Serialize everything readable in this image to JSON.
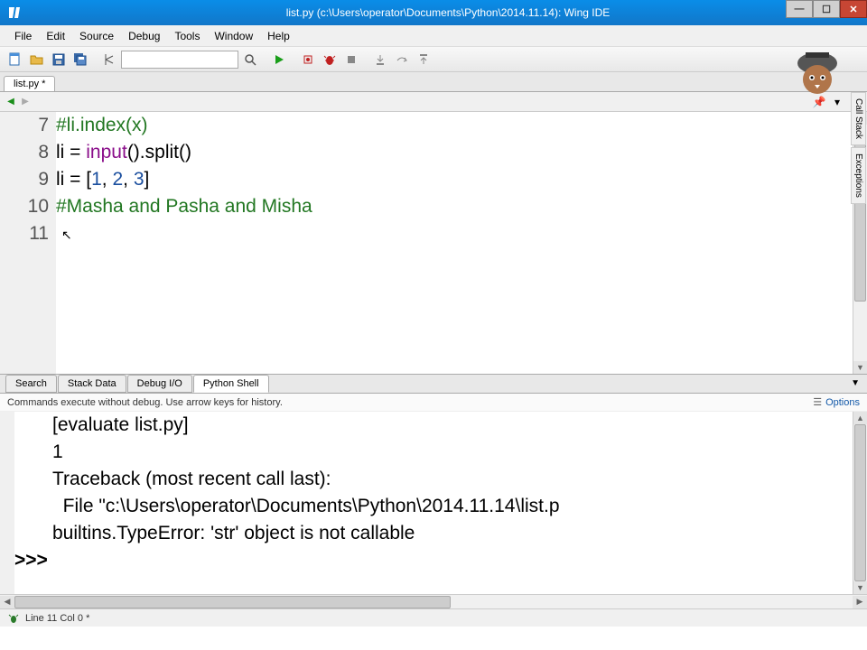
{
  "window": {
    "title": "list.py (c:\\Users\\operator\\Documents\\Python\\2014.11.14): Wing IDE"
  },
  "menu": [
    "File",
    "Edit",
    "Source",
    "Debug",
    "Tools",
    "Window",
    "Help"
  ],
  "toolbar": {
    "search_placeholder": ""
  },
  "file_tab": "list.py *",
  "editor": {
    "line_numbers": [
      "7",
      "8",
      "9",
      "10",
      "11"
    ],
    "lines": [
      {
        "type": "comment",
        "text": "#li.index(x)"
      },
      {
        "type": "code",
        "tokens": [
          "li = ",
          {
            "builtin": "input"
          },
          "().split()"
        ]
      },
      {
        "type": "code",
        "tokens": [
          "li = [",
          {
            "num": "1"
          },
          ", ",
          {
            "num": "2"
          },
          ", ",
          {
            "num": "3"
          },
          "]"
        ]
      },
      {
        "type": "comment",
        "text": "#Masha and Pasha and Misha"
      },
      {
        "type": "code",
        "tokens": [
          ""
        ]
      }
    ]
  },
  "bottom_tabs": [
    "Search",
    "Stack Data",
    "Debug I/O",
    "Python Shell"
  ],
  "bottom_active": 3,
  "shell_header": "Commands execute without debug.  Use arrow keys for history.",
  "options_label": "Options",
  "shell_lines": [
    "[evaluate list.py]",
    "1",
    "Traceback (most recent call last):",
    "  File \"c:\\Users\\operator\\Documents\\Python\\2014.11.14\\list.p",
    "builtins.TypeError: 'str' object is not callable"
  ],
  "prompt": ">>> ",
  "statusbar": "Line 11 Col 0 *",
  "vtabs": [
    "Call Stack",
    "Exceptions"
  ],
  "icons": {
    "new": "📄",
    "open": "📂",
    "save": "💾",
    "saveall": "📚",
    "run": "▶",
    "stop": "■",
    "bug": "🐞",
    "step1": "↧",
    "step2": "↥",
    "step3": "↦"
  }
}
